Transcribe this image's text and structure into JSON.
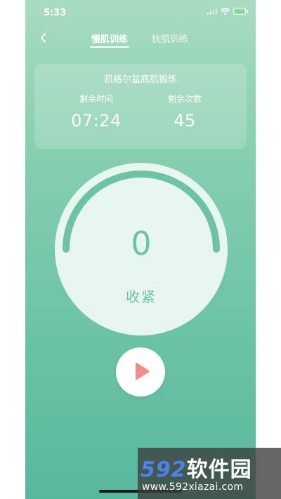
{
  "status_bar": {
    "time": "5:33"
  },
  "nav": {
    "tabs": [
      {
        "label": "慢肌训练",
        "active": true
      },
      {
        "label": "快肌训练",
        "active": false
      }
    ]
  },
  "exercise": {
    "title": "凯格尔盆底肌锻炼",
    "remaining_time_label": "剩余时间",
    "remaining_time": "07:24",
    "remaining_count_label": "剩余次数",
    "remaining_count": "45"
  },
  "dial": {
    "count": "0",
    "phase": "收紧",
    "progress_fraction": 0
  },
  "controls": {
    "play_icon": "play-icon"
  },
  "watermark": {
    "logo_digits": "592",
    "logo_text": "软件园",
    "url": "www.592xiazai.com"
  },
  "colors": {
    "accent": "#6cc4a2",
    "play": "#ef8d86",
    "watermark_blue": "#4d82e8"
  }
}
